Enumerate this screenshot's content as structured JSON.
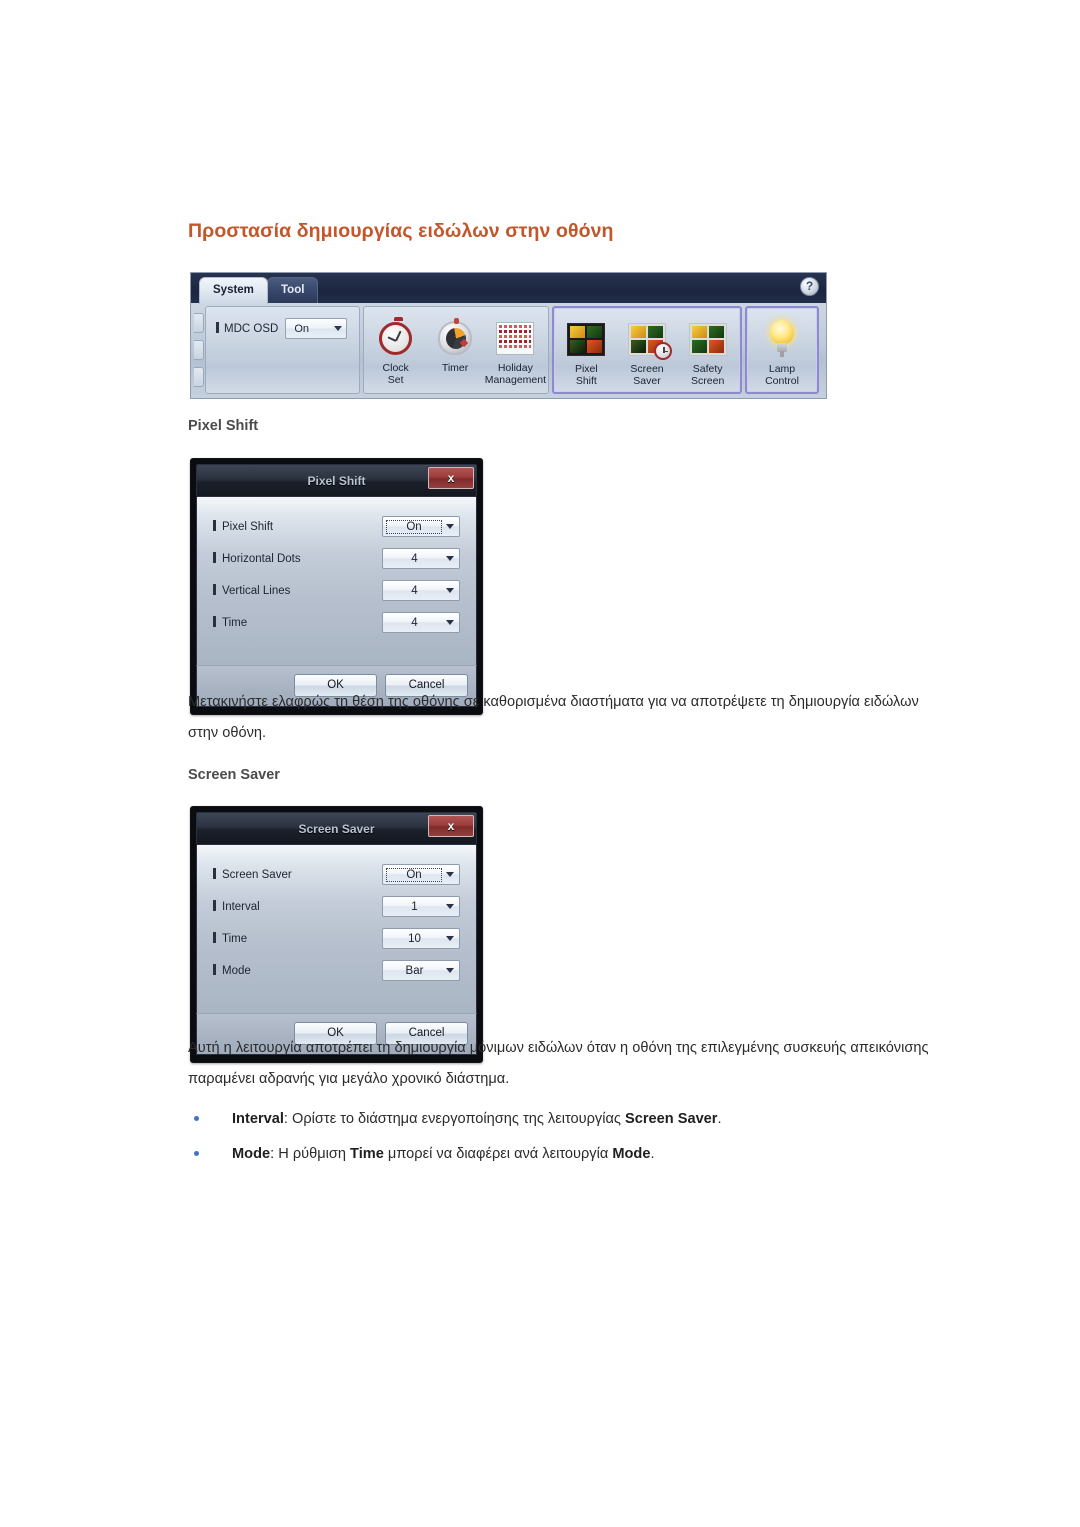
{
  "page": {
    "title": "Προστασία δημιουργίας ειδώλων στην οθόνη",
    "title_color": "#c4562a"
  },
  "ribbon": {
    "tabs": [
      {
        "label": "System",
        "active": true
      },
      {
        "label": "Tool",
        "active": false
      }
    ],
    "help_label": "?",
    "groups": {
      "osd": {
        "label": "MDC OSD",
        "select_value": "On"
      },
      "time": {
        "items": [
          {
            "icon": "clock-icon",
            "line1": "Clock",
            "line2": "Set"
          },
          {
            "icon": "timer-icon",
            "line1": "Timer",
            "line2": ""
          },
          {
            "icon": "calendar-icon",
            "line1": "Holiday",
            "line2": "Management"
          }
        ]
      },
      "screen": {
        "highlighted": true,
        "items": [
          {
            "icon": "pixel-shift-icon",
            "line1": "Pixel",
            "line2": "Shift"
          },
          {
            "icon": "screen-saver-icon",
            "line1": "Screen",
            "line2": "Saver"
          },
          {
            "icon": "safety-screen-icon",
            "line1": "Safety",
            "line2": "Screen"
          }
        ]
      },
      "lamp": {
        "highlighted": true,
        "items": [
          {
            "icon": "lamp-icon",
            "line1": "Lamp",
            "line2": "Control"
          }
        ]
      }
    }
  },
  "sections": [
    {
      "heading": "Pixel Shift",
      "dialog": {
        "title": "Pixel Shift",
        "close_label": "x",
        "fields": [
          {
            "label": "Pixel Shift",
            "value": "On",
            "focused": true
          },
          {
            "label": "Horizontal Dots",
            "value": "4",
            "focused": false
          },
          {
            "label": "Vertical Lines",
            "value": "4",
            "focused": false
          },
          {
            "label": "Time",
            "value": "4",
            "focused": false
          }
        ],
        "ok_label": "OK",
        "cancel_label": "Cancel"
      },
      "paragraph": "Μετακινήστε ελαφρώς τη θέση της οθόνης σε καθορισμένα διαστήματα για να αποτρέψετε τη δημιουργία ειδώλων στην οθόνη."
    },
    {
      "heading": "Screen Saver",
      "dialog": {
        "title": "Screen Saver",
        "close_label": "x",
        "fields": [
          {
            "label": "Screen Saver",
            "value": "On",
            "focused": true
          },
          {
            "label": "Interval",
            "value": "1",
            "focused": false
          },
          {
            "label": "Time",
            "value": "10",
            "focused": false
          },
          {
            "label": "Mode",
            "value": "Bar",
            "focused": false
          }
        ],
        "ok_label": "OK",
        "cancel_label": "Cancel"
      },
      "paragraph": "Αυτή η λειτουργία αποτρέπει τη δημιουργία μόνιμων ειδώλων όταν η οθόνη της επιλεγμένης συσκευής απεικόνισης παραμένει αδρανής για μεγάλο χρονικό διάστημα."
    }
  ],
  "bullets": [
    {
      "term": "Interval",
      "sep": ": ",
      "text_before": "Ορίστε το διάστημα ενεργοποίησης της λειτουργίας ",
      "emphasis": "Screen Saver",
      "text_after": "."
    },
    {
      "term": "Mode",
      "sep": ": ",
      "text_before": "Η ρύθμιση ",
      "emphasis": "Time",
      "mid": " μπορεί να διαφέρει ανά λειτουργία ",
      "emphasis2": "Mode",
      "text_after": "."
    }
  ]
}
